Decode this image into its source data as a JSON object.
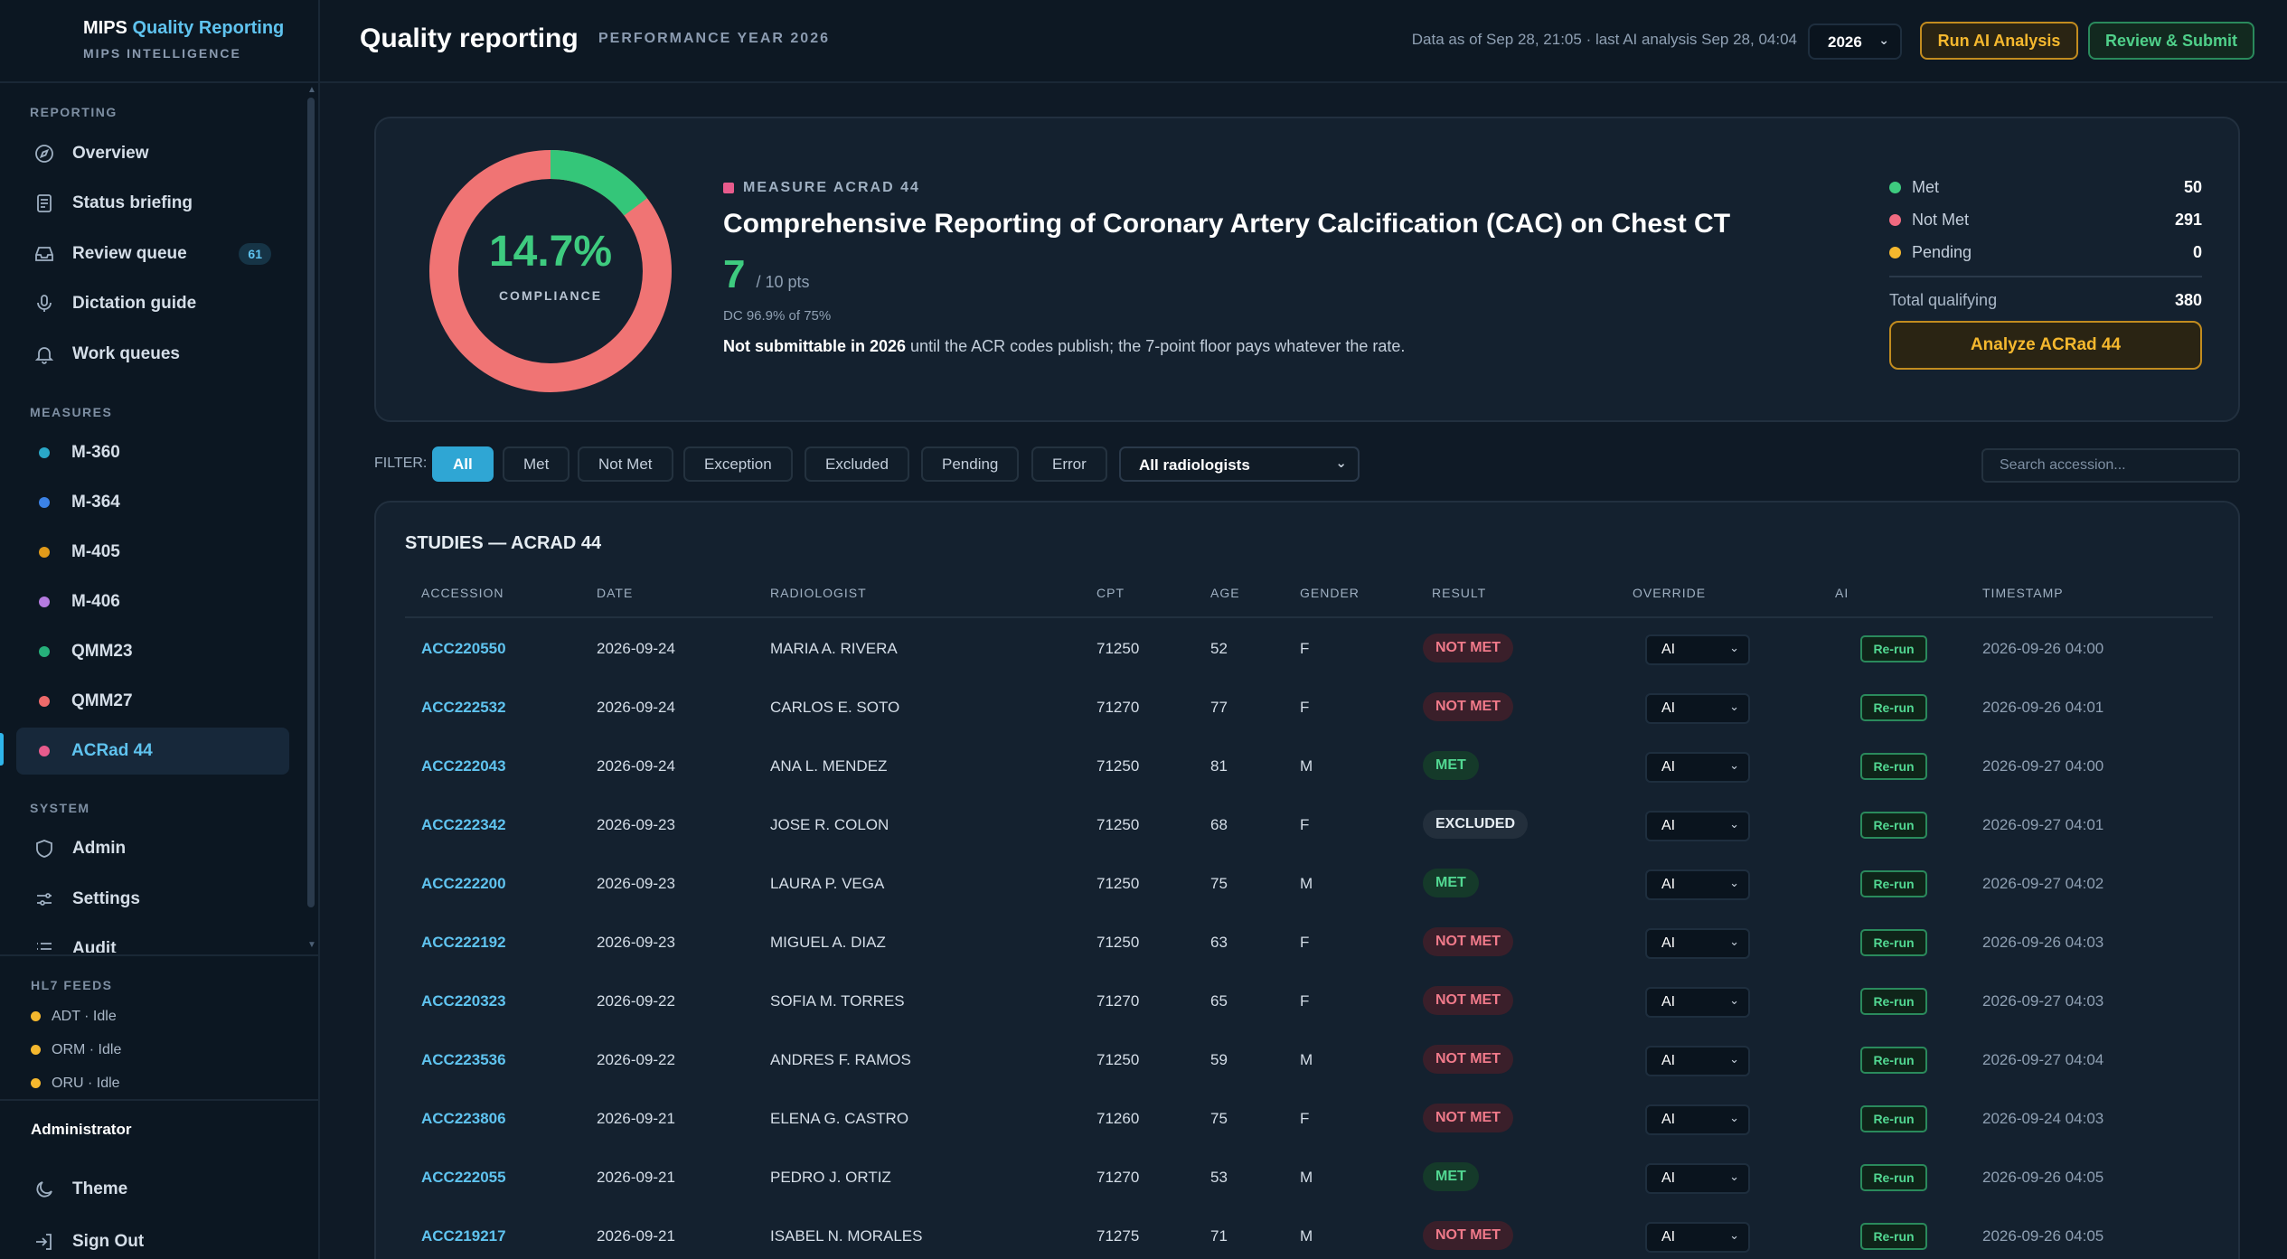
{
  "brand": {
    "name": "MIPS",
    "name_accent": "Quality Reporting",
    "subtitle": "MIPS INTELLIGENCE"
  },
  "sidebar": {
    "sections": {
      "reporting": "REPORTING",
      "measures": "MEASURES",
      "system": "SYSTEM"
    },
    "reporting_items": [
      {
        "label": "Overview",
        "icon": "compass-icon"
      },
      {
        "label": "Status briefing",
        "icon": "document-icon"
      },
      {
        "label": "Review queue",
        "icon": "inbox-icon",
        "badge": "61"
      },
      {
        "label": "Dictation guide",
        "icon": "microphone-icon"
      },
      {
        "label": "Work queues",
        "icon": "bell-icon"
      }
    ],
    "measure_items": [
      {
        "label": "M-360",
        "color": "#2aa8c8"
      },
      {
        "label": "M-364",
        "color": "#3b82e6"
      },
      {
        "label": "M-405",
        "color": "#e09a1a"
      },
      {
        "label": "M-406",
        "color": "#b57be0"
      },
      {
        "label": "QMM23",
        "color": "#26b07a"
      },
      {
        "label": "QMM27",
        "color": "#ee6a6a"
      },
      {
        "label": "ACRad 44",
        "color": "#e85b8c",
        "active": true
      }
    ],
    "system_items": [
      {
        "label": "Admin",
        "icon": "shield-icon"
      },
      {
        "label": "Settings",
        "icon": "sliders-icon"
      },
      {
        "label": "Audit",
        "icon": "list-icon"
      }
    ],
    "hl7": {
      "title": "HL7 FEEDS",
      "feeds": [
        "ADT · Idle",
        "ORM · Idle",
        "ORU · Idle"
      ]
    },
    "user_role": "Administrator",
    "theme_label": "Theme",
    "signout_label": "Sign Out"
  },
  "header": {
    "title": "Quality reporting",
    "subtitle": "PERFORMANCE YEAR 2026",
    "data_as_of": "Data as of Sep 28, 21:05 · last AI analysis Sep 28, 04:04",
    "year": "2026",
    "run_ai_label": "Run AI Analysis",
    "submit_label": "Review & Submit"
  },
  "measure": {
    "tag": "MEASURE ACRAD 44",
    "title": "Comprehensive Reporting of Coronary Artery Calcification (CAC) on Chest CT",
    "score": "7",
    "score_suffix": "/ 10 pts",
    "dc": "DC 96.9% of 75%",
    "note_bold": "Not submittable in 2026",
    "note_rest": " until the ACR codes publish; the 7-point floor pays whatever the rate.",
    "compliance_pct": "14.7%",
    "compliance_label": "COMPLIANCE",
    "compliance_fraction": 0.147,
    "stats": [
      {
        "label": "Met",
        "value": "50",
        "color": "#3ecb7f"
      },
      {
        "label": "Not Met",
        "value": "291",
        "color": "#f06a80"
      },
      {
        "label": "Pending",
        "value": "0",
        "color": "#f5b82e"
      }
    ],
    "total_label": "Total qualifying",
    "total_value": "380",
    "analyze_label": "Analyze ACRad 44"
  },
  "filter": {
    "label": "FILTER:",
    "chips": [
      "All",
      "Met",
      "Not Met",
      "Exception",
      "Excluded",
      "Pending",
      "Error"
    ],
    "active": "All",
    "radiologist": "All radiologists",
    "search_placeholder": "Search accession..."
  },
  "table": {
    "title": "STUDIES — ACRAD 44",
    "columns": [
      "ACCESSION",
      "DATE",
      "RADIOLOGIST",
      "CPT",
      "AGE",
      "GENDER",
      "RESULT",
      "OVERRIDE",
      "AI",
      "TIMESTAMP"
    ],
    "rows": [
      {
        "accession": "ACC220550",
        "date": "2026-09-24",
        "radiologist": "MARIA A. RIVERA",
        "cpt": "71250",
        "age": "52",
        "gender": "F",
        "result": "NOT MET",
        "override": "AI",
        "ai": "Re-run",
        "timestamp": "2026-09-26 04:00"
      },
      {
        "accession": "ACC222532",
        "date": "2026-09-24",
        "radiologist": "CARLOS E. SOTO",
        "cpt": "71270",
        "age": "77",
        "gender": "F",
        "result": "NOT MET",
        "override": "AI",
        "ai": "Re-run",
        "timestamp": "2026-09-26 04:01"
      },
      {
        "accession": "ACC222043",
        "date": "2026-09-24",
        "radiologist": "ANA L. MENDEZ",
        "cpt": "71250",
        "age": "81",
        "gender": "M",
        "result": "MET",
        "override": "AI",
        "ai": "Re-run",
        "timestamp": "2026-09-27 04:00"
      },
      {
        "accession": "ACC222342",
        "date": "2026-09-23",
        "radiologist": "JOSE R. COLON",
        "cpt": "71250",
        "age": "68",
        "gender": "F",
        "result": "EXCLUDED",
        "override": "AI",
        "ai": "Re-run",
        "timestamp": "2026-09-27 04:01"
      },
      {
        "accession": "ACC222200",
        "date": "2026-09-23",
        "radiologist": "LAURA P. VEGA",
        "cpt": "71250",
        "age": "75",
        "gender": "M",
        "result": "MET",
        "override": "AI",
        "ai": "Re-run",
        "timestamp": "2026-09-27 04:02"
      },
      {
        "accession": "ACC222192",
        "date": "2026-09-23",
        "radiologist": "MIGUEL A. DIAZ",
        "cpt": "71250",
        "age": "63",
        "gender": "F",
        "result": "NOT MET",
        "override": "AI",
        "ai": "Re-run",
        "timestamp": "2026-09-26 04:03"
      },
      {
        "accession": "ACC220323",
        "date": "2026-09-22",
        "radiologist": "SOFIA M. TORRES",
        "cpt": "71270",
        "age": "65",
        "gender": "F",
        "result": "NOT MET",
        "override": "AI",
        "ai": "Re-run",
        "timestamp": "2026-09-27 04:03"
      },
      {
        "accession": "ACC223536",
        "date": "2026-09-22",
        "radiologist": "ANDRES F. RAMOS",
        "cpt": "71250",
        "age": "59",
        "gender": "M",
        "result": "NOT MET",
        "override": "AI",
        "ai": "Re-run",
        "timestamp": "2026-09-27 04:04"
      },
      {
        "accession": "ACC223806",
        "date": "2026-09-21",
        "radiologist": "ELENA G. CASTRO",
        "cpt": "71260",
        "age": "75",
        "gender": "F",
        "result": "NOT MET",
        "override": "AI",
        "ai": "Re-run",
        "timestamp": "2026-09-24 04:03"
      },
      {
        "accession": "ACC222055",
        "date": "2026-09-21",
        "radiologist": "PEDRO J. ORTIZ",
        "cpt": "71270",
        "age": "53",
        "gender": "M",
        "result": "MET",
        "override": "AI",
        "ai": "Re-run",
        "timestamp": "2026-09-26 04:05"
      },
      {
        "accession": "ACC219217",
        "date": "2026-09-21",
        "radiologist": "ISABEL N. MORALES",
        "cpt": "71275",
        "age": "71",
        "gender": "M",
        "result": "NOT MET",
        "override": "AI",
        "ai": "Re-run",
        "timestamp": "2026-09-26 04:05"
      }
    ]
  }
}
